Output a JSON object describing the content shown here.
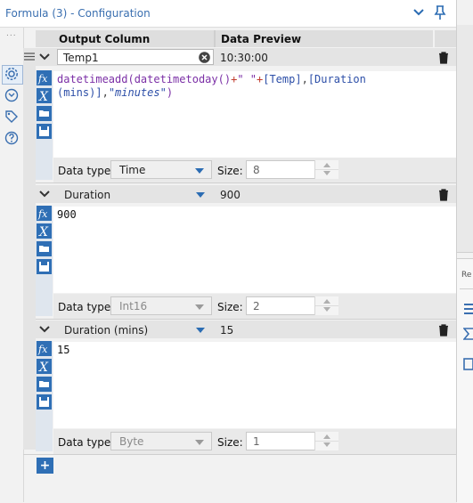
{
  "window": {
    "title": "Formula (3) - Configuration",
    "icons": [
      "chevron-down-icon",
      "pin-icon"
    ]
  },
  "leftbar": {
    "dots": "...",
    "icons": [
      "gear-icon",
      "connection-icon",
      "tag-icon",
      "help-icon"
    ]
  },
  "rightstrip": {
    "tab_label": "Re"
  },
  "grid": {
    "headers": {
      "output_column": "Output Column",
      "data_preview": "Data Preview"
    },
    "rows": [
      {
        "name": "Temp1",
        "name_style": "text-field",
        "preview": "10:30:00",
        "expression": {
          "line1": [
            "datetimeadd(",
            "datetimetoday()",
            "+",
            "\" \"",
            "+",
            "[Temp]",
            ",",
            "[Duration"
          ],
          "line2": [
            "(mins)]",
            ",",
            "\"minutes\"",
            ")"
          ]
        },
        "data_type_label": "Data type:",
        "data_type": "Time",
        "data_type_enabled": true,
        "size_label": "Size:",
        "size": "8"
      },
      {
        "name": "Duration",
        "name_style": "dropdown",
        "preview": "900",
        "expression_text": "900",
        "data_type_label": "Data type:",
        "data_type": "Int16",
        "data_type_enabled": false,
        "size_label": "Size:",
        "size": "2"
      },
      {
        "name": "Duration (mins)",
        "name_style": "dropdown",
        "preview": "15",
        "expression_text": "15",
        "data_type_label": "Data type:",
        "data_type": "Byte",
        "data_type_enabled": false,
        "size_label": "Size:",
        "size": "1"
      }
    ],
    "add_button_label": "+"
  },
  "colors": {
    "accent_blue": "#2f6fb5",
    "title_blue": "#3a6fb0",
    "function_purple": "#7b2fa6",
    "field_blue": "#2d4fa8",
    "operator_red": "#c0392b"
  }
}
